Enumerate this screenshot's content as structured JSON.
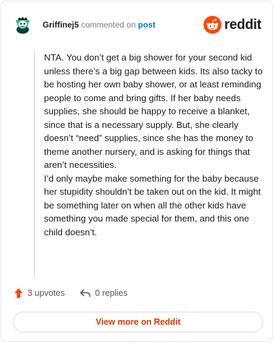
{
  "header": {
    "username": "Griffinej5",
    "middle_text": "commented on",
    "post_link": "post",
    "brand": "reddit",
    "avatar_icon": "snoo-avatar-icon",
    "brand_icon": "reddit-logo-icon"
  },
  "comment": {
    "text": "NTA. You don’t get a big shower for your second kid unless there’s a big gap between kids. Its also tacky to be hosting her own baby shower, or at least reminding people to come and bring gifts. If her baby needs supplies, she should be happy to receive a blanket, since that is a necessary supply. But, she clearly doesn’t “need” supplies, since she has the money to theme another nursery, and is asking for things that aren’t necessities.\nI’d only maybe make something for the baby because her stupidity shouldn’t be taken out on the kid. It might be something later on when all the other kids have something you made special for them, and this one child doesn’t."
  },
  "actions": {
    "upvotes": "3 upvotes",
    "replies": "0 replies",
    "upvote_icon": "upvote-arrow-icon",
    "reply_icon": "reply-arrow-icon"
  },
  "footer": {
    "view_more": "View more on Reddit"
  },
  "colors": {
    "brand": "#ff4500",
    "link": "#0079d3",
    "cta": "#d93a00"
  }
}
